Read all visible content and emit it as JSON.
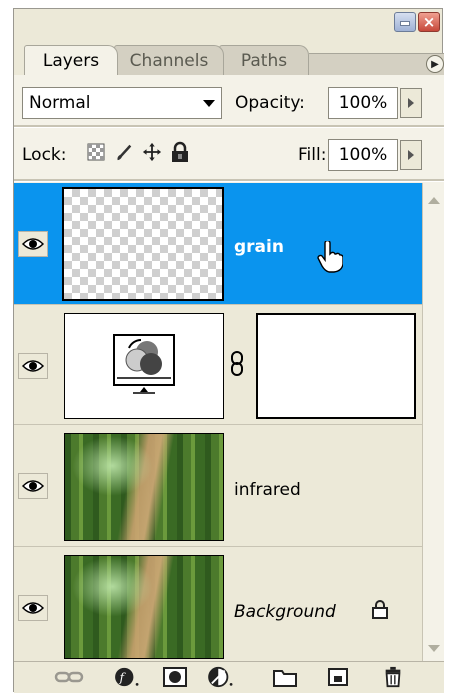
{
  "tabs": [
    "Layers",
    "Channels",
    "Paths"
  ],
  "blend_mode": "Normal",
  "opacity": {
    "label": "Opacity:",
    "value": "100%"
  },
  "lock": {
    "label": "Lock:"
  },
  "fill": {
    "label": "Fill:",
    "value": "100%"
  },
  "layers": [
    {
      "name": "grain",
      "selected": true
    },
    {
      "name": "",
      "selected": false
    },
    {
      "name": "infrared",
      "selected": false
    },
    {
      "name": "Background",
      "selected": false
    }
  ],
  "colors": {
    "selection": "#0a94ee",
    "panel_bg": "#ece9d8"
  }
}
